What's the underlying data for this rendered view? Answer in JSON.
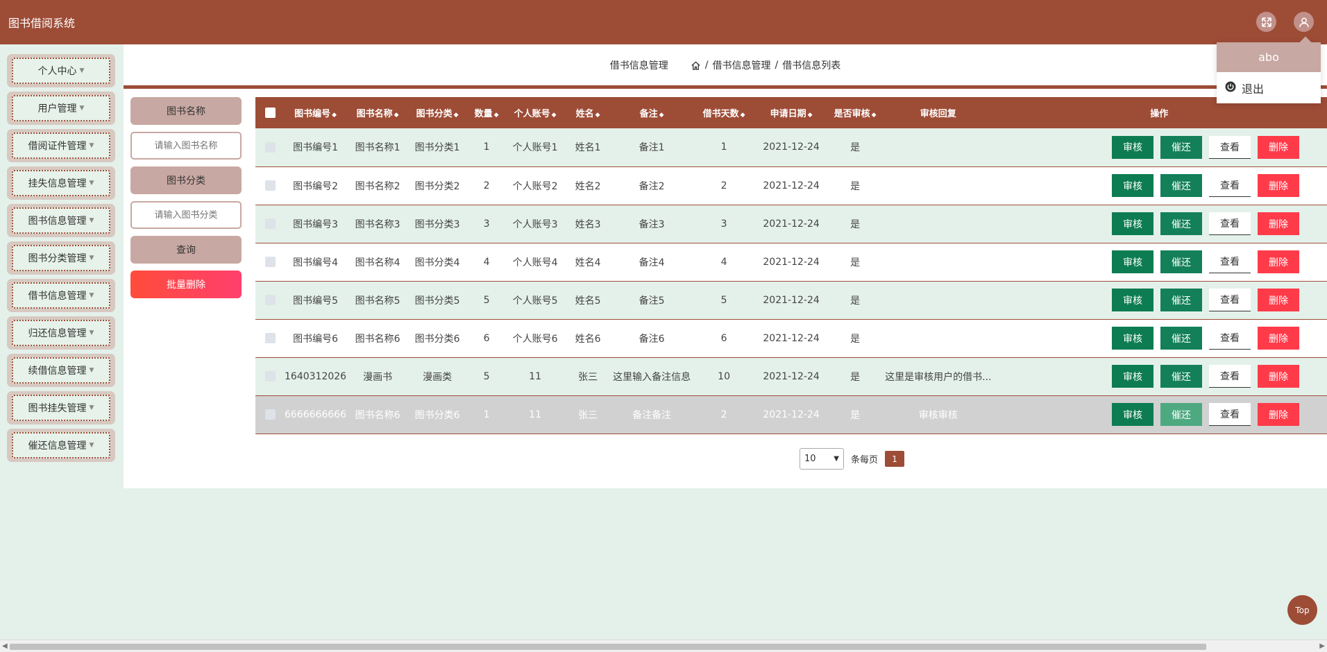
{
  "app": {
    "title": "图书借阅系统"
  },
  "user_menu": {
    "username": "abo",
    "logout": "退出"
  },
  "sidebar": {
    "items": [
      {
        "label": "个人中心"
      },
      {
        "label": "用户管理"
      },
      {
        "label": "借阅证件管理"
      },
      {
        "label": "挂失信息管理"
      },
      {
        "label": "图书信息管理"
      },
      {
        "label": "图书分类管理"
      },
      {
        "label": "借书信息管理"
      },
      {
        "label": "归还信息管理"
      },
      {
        "label": "续借信息管理"
      },
      {
        "label": "图书挂失管理"
      },
      {
        "label": "催还信息管理"
      }
    ]
  },
  "page": {
    "title": "借书信息管理",
    "breadcrumb": [
      "借书信息管理",
      "借书信息列表"
    ],
    "separator": "/"
  },
  "search": {
    "name_label": "图书名称",
    "name_placeholder": "请输入图书名称",
    "category_label": "图书分类",
    "category_placeholder": "请输入图书分类",
    "query_button": "查询",
    "batch_delete_button": "批量删除"
  },
  "table": {
    "columns": [
      "图书编号",
      "图书名称",
      "图书分类",
      "数量",
      "个人账号",
      "姓名",
      "备注",
      "借书天数",
      "申请日期",
      "是否审核",
      "审核回复",
      "操作"
    ],
    "actions": {
      "audit": "审核",
      "remind": "催还",
      "view": "查看",
      "delete": "删除"
    },
    "rows": [
      {
        "code": "图书编号1",
        "name": "图书名称1",
        "category": "图书分类1",
        "qty": "1",
        "account": "个人账号1",
        "person": "姓名1",
        "note": "备注1",
        "days": "1",
        "date": "2021-12-24",
        "audited": "是",
        "reply": ""
      },
      {
        "code": "图书编号2",
        "name": "图书名称2",
        "category": "图书分类2",
        "qty": "2",
        "account": "个人账号2",
        "person": "姓名2",
        "note": "备注2",
        "days": "2",
        "date": "2021-12-24",
        "audited": "是",
        "reply": ""
      },
      {
        "code": "图书编号3",
        "name": "图书名称3",
        "category": "图书分类3",
        "qty": "3",
        "account": "个人账号3",
        "person": "姓名3",
        "note": "备注3",
        "days": "3",
        "date": "2021-12-24",
        "audited": "是",
        "reply": ""
      },
      {
        "code": "图书编号4",
        "name": "图书名称4",
        "category": "图书分类4",
        "qty": "4",
        "account": "个人账号4",
        "person": "姓名4",
        "note": "备注4",
        "days": "4",
        "date": "2021-12-24",
        "audited": "是",
        "reply": ""
      },
      {
        "code": "图书编号5",
        "name": "图书名称5",
        "category": "图书分类5",
        "qty": "5",
        "account": "个人账号5",
        "person": "姓名5",
        "note": "备注5",
        "days": "5",
        "date": "2021-12-24",
        "audited": "是",
        "reply": ""
      },
      {
        "code": "图书编号6",
        "name": "图书名称6",
        "category": "图书分类6",
        "qty": "6",
        "account": "个人账号6",
        "person": "姓名6",
        "note": "备注6",
        "days": "6",
        "date": "2021-12-24",
        "audited": "是",
        "reply": ""
      },
      {
        "code": "1640312026",
        "name": "漫画书",
        "category": "漫画类",
        "qty": "5",
        "account": "11",
        "person": "张三",
        "note": "这里输入备注信息",
        "days": "10",
        "date": "2021-12-24",
        "audited": "是",
        "reply": "这里是审核用户的借书..."
      },
      {
        "code": "6666666666",
        "name": "图书名称6",
        "category": "图书分类6",
        "qty": "1",
        "account": "11",
        "person": "张三",
        "note": "备注备注",
        "days": "2",
        "date": "2021-12-24",
        "audited": "是",
        "reply": "审核审核"
      }
    ]
  },
  "pagination": {
    "page_size": "10",
    "per_page_label": "条每页",
    "current_page": "1"
  },
  "back_to_top": "Top",
  "colors": {
    "primary": "#9d4c36",
    "background": "#e4f1ea",
    "success": "#0e7c52",
    "danger": "#ff3b4a"
  }
}
